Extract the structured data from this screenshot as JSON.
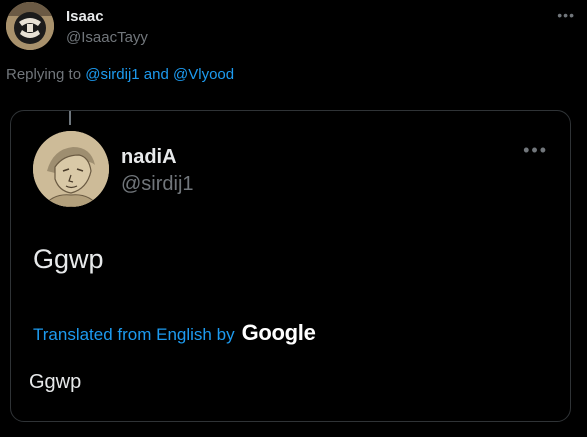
{
  "outer_tweet": {
    "author_name": "Isaac",
    "author_handle": "@IsaacTayy",
    "reply_prefix": "Replying to",
    "reply_mention_1": "@sirdij1",
    "reply_and": "and",
    "reply_mention_2": "@Vlyood",
    "avatar_icon": "avatar-logo-icon"
  },
  "quoted_tweet": {
    "author_name": "nadiA",
    "author_handle": "@sirdij1",
    "text": "Ggwp",
    "translation_label": "Translated from English by",
    "translation_provider": "Google",
    "translated_text": "Ggwp"
  },
  "colors": {
    "background": "#000000",
    "primary_text": "#e7e9ea",
    "secondary_text": "#71767b",
    "accent": "#1d9bf0",
    "border": "#2f3336"
  }
}
